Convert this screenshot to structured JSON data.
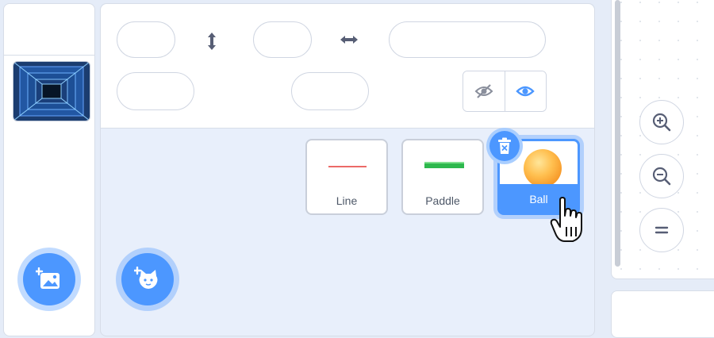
{
  "stage": {
    "backdrop_thumbnail": "tunnel-backdrop-image",
    "choose_backdrop_icon": "add-image-icon"
  },
  "sprite_info": {
    "y_icon": "vertical-arrows-icon",
    "x_icon": "horizontal-arrows-icon",
    "hide_icon": "eye-slash-icon",
    "show_icon": "eye-icon"
  },
  "sprites": [
    {
      "name": "Line",
      "icon": "line-costume"
    },
    {
      "name": "Paddle",
      "icon": "paddle-costume"
    },
    {
      "name": "Ball",
      "icon": "ball-costume",
      "selected": true
    }
  ],
  "sprite_list": {
    "delete_icon": "trash-icon",
    "choose_sprite_icon": "add-sprite-cat-icon"
  },
  "zoom": {
    "zoom_in_icon": "zoom-in-icon",
    "zoom_out_icon": "zoom-out-icon",
    "reset_icon": "equals-icon"
  },
  "colors": {
    "accent": "#4c97ff",
    "line_color": "#e53935",
    "paddle_color": "#2db84d",
    "ball_color": "#ffb545"
  }
}
